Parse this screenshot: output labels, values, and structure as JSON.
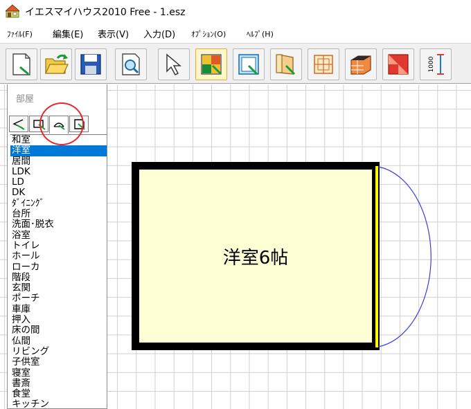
{
  "window": {
    "title": "イエスマイハウス2010 Free - 1.esz",
    "icon": "house-app-icon"
  },
  "menu": {
    "items": [
      {
        "label": "ﾌｧｲﾙ(F)"
      },
      {
        "label": "編集(E)"
      },
      {
        "label": "表示(V)"
      },
      {
        "label": "入力(D)"
      },
      {
        "label": "ｵﾌﾟｼｮﾝ(O)"
      },
      {
        "label": "ﾍﾙﾌﾟ(H)"
      }
    ]
  },
  "toolbar": {
    "buttons": [
      {
        "icon": "new-file-icon"
      },
      {
        "icon": "open-folder-icon"
      },
      {
        "icon": "save-icon"
      },
      {
        "icon": "preview-icon"
      },
      {
        "icon": "select-arrow-icon"
      },
      {
        "icon": "room-tool-icon",
        "active": true
      },
      {
        "icon": "window-tool-icon"
      },
      {
        "icon": "door-tool-icon"
      },
      {
        "icon": "fixture-tool-icon"
      },
      {
        "icon": "wall-3d-icon"
      },
      {
        "icon": "roof-icon"
      },
      {
        "icon": "dimension-icon",
        "label": "1000"
      }
    ]
  },
  "room_panel": {
    "title": "部屋",
    "shape_tabs": [
      {
        "icon": "angle-shape-icon"
      },
      {
        "icon": "rect-shape-icon"
      },
      {
        "icon": "arc-shape-icon",
        "active": true
      },
      {
        "icon": "custom-shape-icon"
      }
    ],
    "room_types": [
      "和室",
      "洋室",
      "居間",
      "LDK",
      "LD",
      "DK",
      "ﾀﾞｲﾆﾝｸﾞ",
      "台所",
      "洗面･脱衣",
      "浴室",
      "トイレ",
      "ホール",
      "ローカ",
      "階段",
      "玄関",
      "ポーチ",
      "車庫",
      "押入",
      "床の間",
      "仏間",
      "リビング",
      "子供室",
      "寝室",
      "書斎",
      "食堂",
      "キッチン"
    ],
    "selected": "洋室"
  },
  "plan": {
    "room_label": "洋室6帖",
    "colors": {
      "room_fill": "#ffffd6",
      "wall": "#000000",
      "door": "#ffff00",
      "door_swing": "#3b3bdc",
      "grid": "#cfcfcf",
      "highlight": "#e8262c"
    }
  }
}
